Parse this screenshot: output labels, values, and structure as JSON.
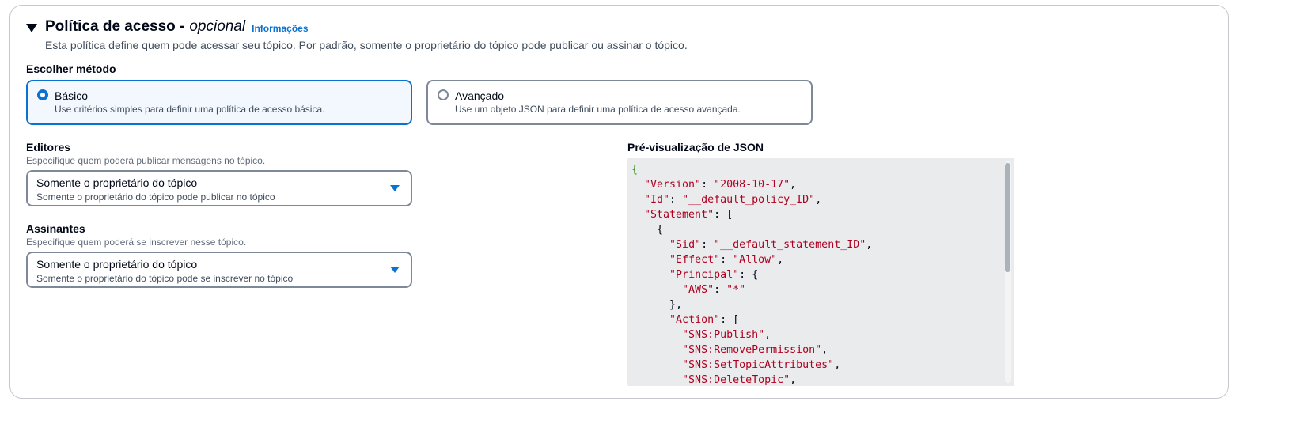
{
  "section": {
    "title": "Política de acesso -",
    "title_optional": "opcional",
    "info_link": "Informações",
    "description": "Esta política define quem pode acessar seu tópico. Por padrão, somente o proprietário do tópico pode publicar ou assinar o tópico."
  },
  "method": {
    "label": "Escolher método",
    "options": [
      {
        "title": "Básico",
        "description": "Use critérios simples para definir uma política de acesso básica.",
        "selected": true
      },
      {
        "title": "Avançado",
        "description": "Use um objeto JSON para definir uma política de acesso avançada.",
        "selected": false
      }
    ]
  },
  "publishers": {
    "label": "Editores",
    "sublabel": "Especifique quem poderá publicar mensagens no tópico.",
    "value": "Somente o proprietário do tópico",
    "value_description": "Somente o proprietário do tópico pode publicar no tópico"
  },
  "subscribers": {
    "label": "Assinantes",
    "sublabel": "Especifique quem poderá se inscrever nesse tópico.",
    "value": "Somente o proprietário do tópico",
    "value_description": "Somente o proprietário do tópico pode se inscrever no tópico"
  },
  "json_preview": {
    "label": "Pré-visualização de JSON",
    "lines": [
      {
        "indent": 0,
        "tokens": [
          {
            "t": "{",
            "c": "g"
          }
        ]
      },
      {
        "indent": 1,
        "tokens": [
          {
            "t": "\"Version\"",
            "c": "k"
          },
          {
            "t": ": ",
            "c": ""
          },
          {
            "t": "\"2008-10-17\"",
            "c": "s"
          },
          {
            "t": ",",
            "c": ""
          }
        ]
      },
      {
        "indent": 1,
        "tokens": [
          {
            "t": "\"Id\"",
            "c": "k"
          },
          {
            "t": ": ",
            "c": ""
          },
          {
            "t": "\"__default_policy_ID\"",
            "c": "s"
          },
          {
            "t": ",",
            "c": ""
          }
        ]
      },
      {
        "indent": 1,
        "tokens": [
          {
            "t": "\"Statement\"",
            "c": "k"
          },
          {
            "t": ": [",
            "c": ""
          }
        ]
      },
      {
        "indent": 2,
        "tokens": [
          {
            "t": "{",
            "c": ""
          }
        ]
      },
      {
        "indent": 3,
        "tokens": [
          {
            "t": "\"Sid\"",
            "c": "k"
          },
          {
            "t": ": ",
            "c": ""
          },
          {
            "t": "\"__default_statement_ID\"",
            "c": "s"
          },
          {
            "t": ",",
            "c": ""
          }
        ]
      },
      {
        "indent": 3,
        "tokens": [
          {
            "t": "\"Effect\"",
            "c": "k"
          },
          {
            "t": ": ",
            "c": ""
          },
          {
            "t": "\"Allow\"",
            "c": "s"
          },
          {
            "t": ",",
            "c": ""
          }
        ]
      },
      {
        "indent": 3,
        "tokens": [
          {
            "t": "\"Principal\"",
            "c": "k"
          },
          {
            "t": ": {",
            "c": ""
          }
        ]
      },
      {
        "indent": 4,
        "tokens": [
          {
            "t": "\"AWS\"",
            "c": "k"
          },
          {
            "t": ": ",
            "c": ""
          },
          {
            "t": "\"*\"",
            "c": "s"
          }
        ]
      },
      {
        "indent": 3,
        "tokens": [
          {
            "t": "},",
            "c": ""
          }
        ]
      },
      {
        "indent": 3,
        "tokens": [
          {
            "t": "\"Action\"",
            "c": "k"
          },
          {
            "t": ": [",
            "c": ""
          }
        ]
      },
      {
        "indent": 4,
        "tokens": [
          {
            "t": "\"SNS:Publish\"",
            "c": "s"
          },
          {
            "t": ",",
            "c": ""
          }
        ]
      },
      {
        "indent": 4,
        "tokens": [
          {
            "t": "\"SNS:RemovePermission\"",
            "c": "s"
          },
          {
            "t": ",",
            "c": ""
          }
        ]
      },
      {
        "indent": 4,
        "tokens": [
          {
            "t": "\"SNS:SetTopicAttributes\"",
            "c": "s"
          },
          {
            "t": ",",
            "c": ""
          }
        ]
      },
      {
        "indent": 4,
        "tokens": [
          {
            "t": "\"SNS:DeleteTopic\"",
            "c": "s"
          },
          {
            "t": ",",
            "c": ""
          }
        ]
      }
    ]
  },
  "colors": {
    "accent": "#0972d3",
    "json_key": "#b00020",
    "json_brace": "#1d8102"
  }
}
